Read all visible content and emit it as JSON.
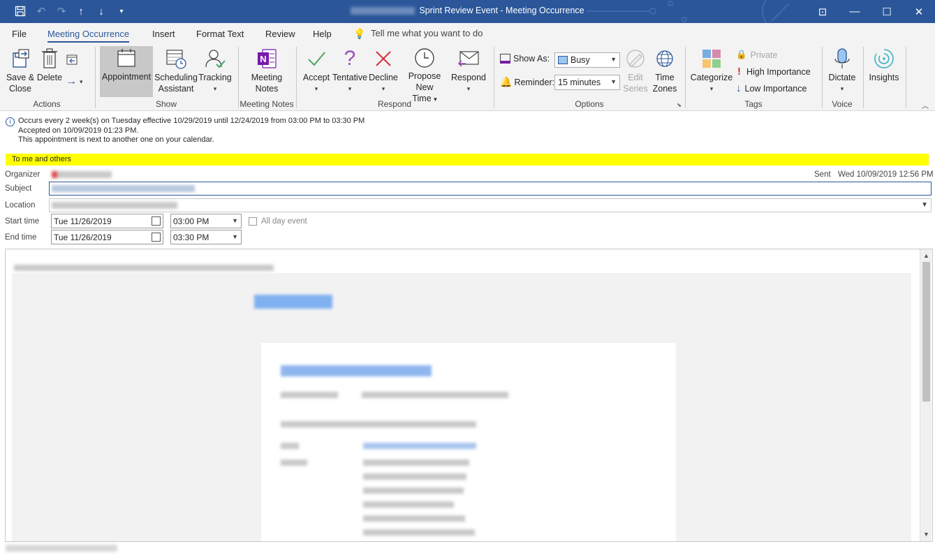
{
  "titlebar": {
    "title": "Sprint Review Event  -  Meeting Occurrence",
    "buttons": {
      "restore_ribbon": "⊡",
      "minimize": "—",
      "maximize": "☐",
      "close": "✕"
    }
  },
  "menu": {
    "tabs": [
      "File",
      "Meeting Occurrence",
      "Insert",
      "Format Text",
      "Review",
      "Help"
    ],
    "active_tab": "Meeting Occurrence",
    "tell_me": "Tell me what you want to do"
  },
  "ribbon": {
    "actions": {
      "save_close": [
        "Save &",
        "Close"
      ],
      "delete": "Delete",
      "group": "Actions"
    },
    "show": {
      "appointment": "Appointment",
      "scheduling": [
        "Scheduling",
        "Assistant"
      ],
      "tracking": "Tracking",
      "group": "Show"
    },
    "notes": {
      "meeting_notes": [
        "Meeting",
        "Notes"
      ],
      "group": "Meeting Notes"
    },
    "respond": {
      "accept": "Accept",
      "tentative": "Tentative",
      "decline": "Decline",
      "propose": [
        "Propose New",
        "Time"
      ],
      "respond": "Respond",
      "group": "Respond"
    },
    "options": {
      "show_as_label": "Show As:",
      "show_as_value": "Busy",
      "reminder_label": "Reminder:",
      "reminder_value": "15 minutes",
      "edit_series": [
        "Edit",
        "Series"
      ],
      "time_zones": [
        "Time",
        "Zones"
      ],
      "group": "Options"
    },
    "tags": {
      "categorize": "Categorize",
      "private": "Private",
      "high": "High Importance",
      "low": "Low Importance",
      "group": "Tags"
    },
    "voice": {
      "dictate": "Dictate",
      "group": "Voice"
    },
    "insights": {
      "label": "Insights"
    }
  },
  "info": {
    "line1": "Occurs every 2 week(s) on Tuesday effective 10/29/2019 until 12/24/2019 from 03:00 PM to 03:30 PM",
    "line2": "Accepted on 10/09/2019 01:23 PM.",
    "line3": "This appointment is next to another one on your calendar."
  },
  "recipients_bar": "To me and others",
  "form": {
    "organizer_label": "Organizer",
    "sent_label": "Sent",
    "sent_value": "Wed 10/09/2019 12:56 PM",
    "subject_label": "Subject",
    "location_label": "Location",
    "start_label": "Start time",
    "start_date": "Tue 11/26/2019",
    "start_time": "03:00 PM",
    "all_day_label": "All day event",
    "end_label": "End time",
    "end_date": "Tue 11/26/2019",
    "end_time": "03:30 PM"
  },
  "colors": {
    "title_blue": "#2b579a",
    "ribbon_bg": "#f3f3f3",
    "yellow_bar": "#ffff00",
    "accept_green": "#4aa564",
    "tentative_purple": "#9b4fb9",
    "decline_red": "#d13438",
    "onenote_purple": "#7719aa",
    "blurred_link": "#8fb6ef"
  }
}
